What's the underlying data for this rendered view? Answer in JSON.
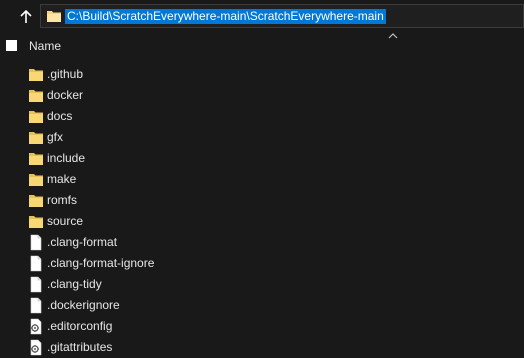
{
  "address_bar": {
    "path": "C:\\Build\\ScratchEverywhere-main\\ScratchEverywhere-main"
  },
  "columns": {
    "name_label": "Name"
  },
  "items": [
    {
      "name": ".github",
      "type": "folder"
    },
    {
      "name": "docker",
      "type": "folder"
    },
    {
      "name": "docs",
      "type": "folder"
    },
    {
      "name": "gfx",
      "type": "folder"
    },
    {
      "name": "include",
      "type": "folder"
    },
    {
      "name": "make",
      "type": "folder"
    },
    {
      "name": "romfs",
      "type": "folder"
    },
    {
      "name": "source",
      "type": "folder"
    },
    {
      "name": ".clang-format",
      "type": "file"
    },
    {
      "name": ".clang-format-ignore",
      "type": "file"
    },
    {
      "name": ".clang-tidy",
      "type": "file"
    },
    {
      "name": ".dockerignore",
      "type": "file"
    },
    {
      "name": ".editorconfig",
      "type": "config"
    },
    {
      "name": ".gitattributes",
      "type": "config"
    }
  ],
  "colors": {
    "background": "#191919",
    "selection": "#0078d7",
    "folder": "#f8d775",
    "text": "#e6e6e6"
  }
}
